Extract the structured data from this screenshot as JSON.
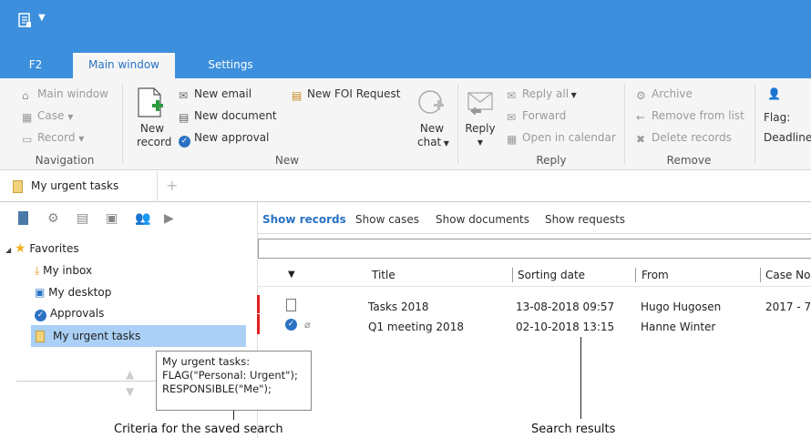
{
  "colors": {
    "accent": "#3c8fdc",
    "urgent_flag": "#e02020",
    "selected": "#aad0f5"
  },
  "title_bar": {
    "app_icon": "f2-app-icon",
    "quick_access": "dropdown-arrow-icon"
  },
  "ribbon_tabs": [
    {
      "label": "F2"
    },
    {
      "label": "Main window"
    },
    {
      "label": "Settings"
    }
  ],
  "ribbon": {
    "navigation": {
      "group": "Navigation",
      "main_window": "Main window",
      "case": "Case",
      "record": "Record"
    },
    "new": {
      "group": "New",
      "new_record_1": "New",
      "new_record_2": "record",
      "new_email": "New email",
      "new_document": "New document",
      "new_approval": "New approval",
      "new_foi": "New FOI Request",
      "new_chat_1": "New",
      "new_chat_2": "chat"
    },
    "reply": {
      "group": "Reply",
      "reply": "Reply",
      "reply_all": "Reply all",
      "forward": "Forward",
      "open_calendar": "Open in calendar"
    },
    "remove": {
      "group": "Remove",
      "archive": "Archive",
      "remove_list": "Remove from list",
      "delete_records": "Delete records"
    },
    "flag": {
      "flag": "Flag:",
      "deadline": "Deadline"
    }
  },
  "doc_tab": {
    "label": "My urgent tasks",
    "add": "+"
  },
  "favorites": {
    "header": "Favorites",
    "items": [
      "My inbox",
      "My desktop",
      "Approvals",
      "My urgent tasks"
    ]
  },
  "tooltip": {
    "line1": "My urgent tasks:",
    "line2": "FLAG(\"Personal: Urgent\");",
    "line3": "RESPONSIBLE(\"Me\");"
  },
  "view_tabs": [
    "Show records",
    "Show cases",
    "Show documents",
    "Show requests"
  ],
  "table": {
    "columns": [
      "Title",
      "Sorting date",
      "From",
      "Case No"
    ],
    "rows": [
      {
        "title": "Tasks 2018",
        "date": "13-08-2018 09:57",
        "from": "Hugo Hugosen",
        "case": "2017 - 7"
      },
      {
        "title": "Q1 meeting 2018",
        "date": "02-10-2018 13:15",
        "from": "Hanne Winter",
        "case": ""
      }
    ]
  },
  "callouts": {
    "left": "Criteria for the saved search",
    "right": "Search results"
  }
}
